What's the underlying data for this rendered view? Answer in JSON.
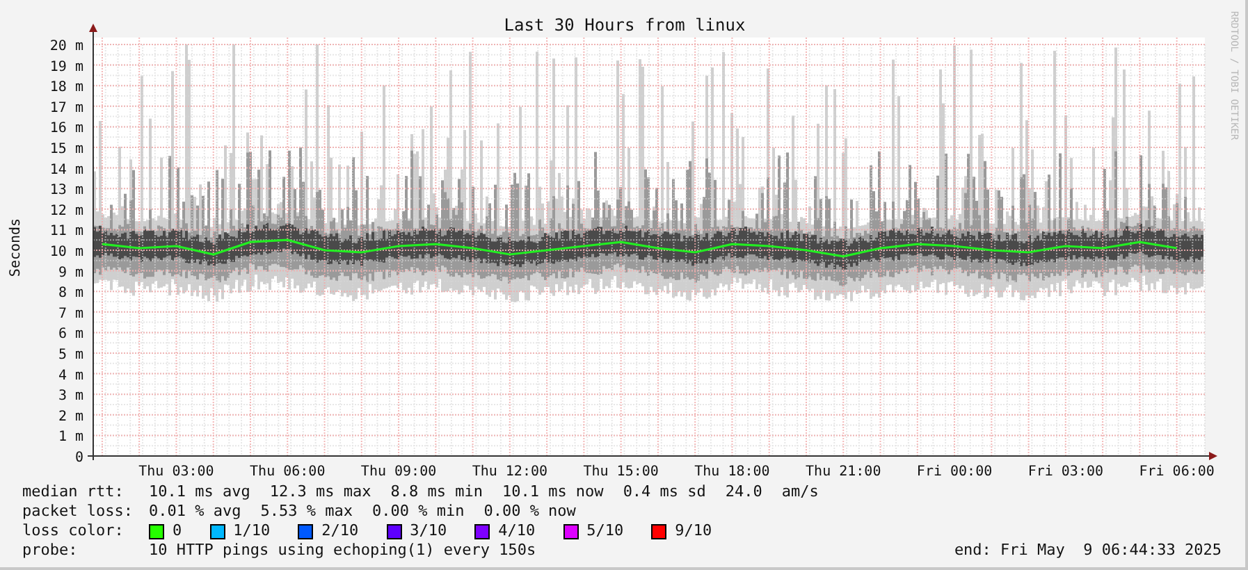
{
  "credit": "RRDTOOL / TOBI OETIKER",
  "chart_data": {
    "type": "line",
    "title": "Last 30 Hours from linux",
    "ylabel": "Seconds",
    "ylim": [
      0,
      20
    ],
    "grid": true,
    "categories": [
      null,
      null,
      "Thu 03:00",
      null,
      null,
      "Thu 06:00",
      null,
      null,
      "Thu 09:00",
      null,
      null,
      "Thu 12:00",
      null,
      null,
      "Thu 15:00",
      null,
      null,
      "Thu 18:00",
      null,
      null,
      "Thu 21:00",
      null,
      null,
      "Fri 00:00",
      null,
      null,
      "Fri 03:00",
      null,
      null,
      "Fri 06:00"
    ],
    "yticks": [
      {
        "value": 0,
        "label": "0"
      },
      {
        "value": 1,
        "label": "1 m"
      },
      {
        "value": 2,
        "label": "2 m"
      },
      {
        "value": 3,
        "label": "3 m"
      },
      {
        "value": 4,
        "label": "4 m"
      },
      {
        "value": 5,
        "label": "5 m"
      },
      {
        "value": 6,
        "label": "6 m"
      },
      {
        "value": 7,
        "label": "7 m"
      },
      {
        "value": 8,
        "label": "8 m"
      },
      {
        "value": 9,
        "label": "9 m"
      },
      {
        "value": 10,
        "label": "10 m"
      },
      {
        "value": 11,
        "label": "11 m"
      },
      {
        "value": 12,
        "label": "12 m"
      },
      {
        "value": 13,
        "label": "13 m"
      },
      {
        "value": 14,
        "label": "14 m"
      },
      {
        "value": 15,
        "label": "15 m"
      },
      {
        "value": 16,
        "label": "16 m"
      },
      {
        "value": 17,
        "label": "17 m"
      },
      {
        "value": 18,
        "label": "18 m"
      },
      {
        "value": 19,
        "label": "19 m"
      },
      {
        "value": 20,
        "label": "20 m"
      }
    ],
    "series": [
      {
        "color": "#22ee22",
        "values": [
          10.3,
          10.1,
          10.2,
          9.8,
          10.4,
          10.5,
          10,
          9.9,
          10.2,
          10.3,
          10.1,
          9.8,
          10,
          10.2,
          10.4,
          10.1,
          9.9,
          10.3,
          10.2,
          10,
          9.7,
          10.1,
          10.3,
          10.2,
          10,
          9.9,
          10.2,
          10.1,
          10.4,
          10.1
        ]
      }
    ]
  },
  "legend": {
    "median_rtt": {
      "label": "median rtt:",
      "items": [
        "10.1 ms avg",
        "12.3 ms max",
        "8.8 ms min",
        "10.1 ms now",
        "0.4 ms sd",
        "24.0",
        "am/s"
      ]
    },
    "packet_loss": {
      "label": "packet loss:",
      "items": [
        "0.01 % avg",
        "5.53 % max",
        "0.00 % min",
        "0.00 % now"
      ]
    },
    "loss_color": {
      "label": "loss color:",
      "items": [
        {
          "label": "0",
          "color": "#26ff00"
        },
        {
          "label": "1/10",
          "color": "#00b8ff"
        },
        {
          "label": "2/10",
          "color": "#0059ff"
        },
        {
          "label": "3/10",
          "color": "#5e00ff"
        },
        {
          "label": "4/10",
          "color": "#7e00ff"
        },
        {
          "label": "5/10",
          "color": "#dd00ff"
        },
        {
          "label": "9/10",
          "color": "#ff0000"
        }
      ]
    },
    "probe": {
      "label": "probe:",
      "text": "10 HTTP pings using echoping(1) every 150s"
    },
    "end": "end: Fri May  9 06:44:33 2025"
  }
}
